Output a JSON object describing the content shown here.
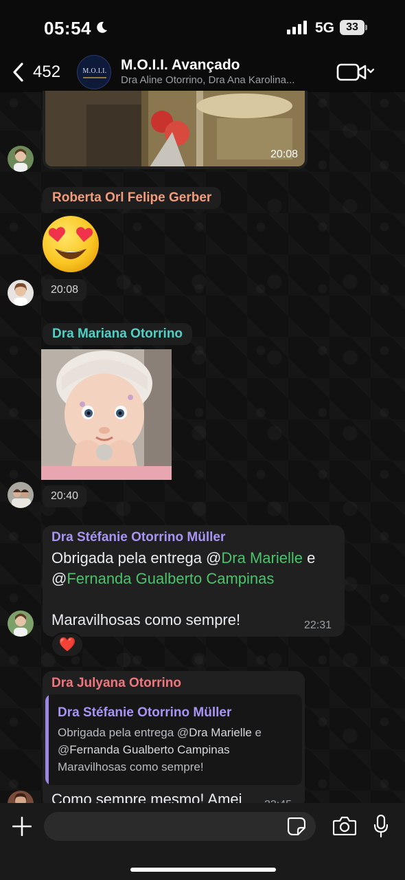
{
  "status_bar": {
    "time": "05:54",
    "network": "5G",
    "battery": "33"
  },
  "header": {
    "back_count": "452",
    "avatar_text": "M.O.I.I.",
    "title": "M.O.I.I. Avançado",
    "subtitle": "Dra Aline Otorrino, Dra Ana Karolina..."
  },
  "messages": [
    {
      "type": "image",
      "time": "20:08"
    },
    {
      "type": "emoji",
      "sender": "Roberta Orl Felipe Gerber",
      "sender_color": "#f29c7a",
      "emoji": "😍",
      "time": "20:08"
    },
    {
      "type": "image",
      "sender": "Dra Mariana Otorrino",
      "sender_color": "#4fd1c5",
      "time": "20:40"
    },
    {
      "type": "text",
      "sender": "Dra Stéfanie Otorrino Müller",
      "sender_color": "#a894f5",
      "line1_prefix": "Obrigada pela entrega @",
      "mention1": "Dra Marielle",
      "line1_suffix": " e",
      "line2_prefix": "@",
      "mention2": "Fernanda Gualberto Campinas",
      "line3": "Maravilhosas como sempre!",
      "time": "22:31",
      "reaction": "❤️"
    },
    {
      "type": "reply",
      "sender": "Dra Julyana Otorrino",
      "sender_color": "#f0767e",
      "quote_sender": "Dra Stéfanie Otorrino Müller",
      "quote_line1_prefix": "Obrigada pela entrega @",
      "quote_mention1": "Dra Marielle",
      "quote_line1_suffix": " e",
      "quote_line2_prefix": "@",
      "quote_mention2": "Fernanda Gualberto Campinas",
      "quote_line3": "Maravilhosas como sempre!",
      "text": "Como sempre mesmo! Amei",
      "time": "22:45"
    }
  ],
  "input": {
    "placeholder": ""
  },
  "colors": {
    "mention": "#4cc36a",
    "bubble": "#202020",
    "background": "#111111"
  },
  "icons": [
    "moon-icon",
    "signal-icon",
    "back-icon",
    "video-call-icon",
    "plus-icon",
    "sticker-icon",
    "camera-icon",
    "mic-icon"
  ]
}
